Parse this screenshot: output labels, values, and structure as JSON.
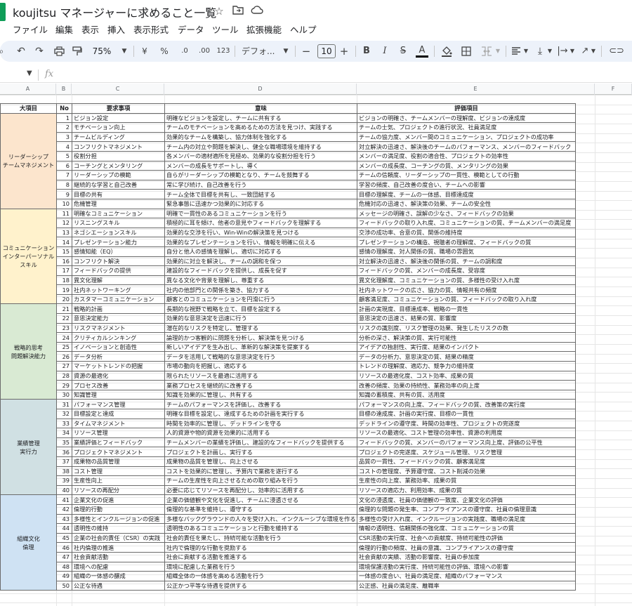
{
  "app": {
    "title": "koujitsu マネージャーに求めること一覧",
    "icons": [
      "star-icon",
      "move-to-folder-icon",
      "cloud-status-icon"
    ]
  },
  "menu": [
    "ファイル",
    "編集",
    "表示",
    "挿入",
    "表示形式",
    "データ",
    "ツール",
    "拡張機能",
    "ヘルプ"
  ],
  "toolbar": {
    "zoom": "75%",
    "currency": "¥",
    "percent": "%",
    "dec_decrease": ".0",
    "dec_increase": ".00",
    "number_format": "123",
    "font": "デフォ...",
    "font_size": "10",
    "minus": "−",
    "plus": "+",
    "bold": "B",
    "italic": "I",
    "strike": "S",
    "text_color": "A"
  },
  "formula_bar": {
    "fx": "fx"
  },
  "columns": [
    "A",
    "B",
    "C",
    "D",
    "E",
    "F"
  ],
  "table": {
    "headers": [
      "大項目",
      "No",
      "要求事項",
      "意味",
      "評価項目"
    ],
    "categories": [
      {
        "label": "リーダーシップ\nチームマネジメント",
        "rows": 10,
        "color": "#fce5cd",
        "cls": "c-leader"
      },
      {
        "label": "コミュニケーション\nインターパーソナルスキル",
        "rows": 10,
        "color": "#fff2cc",
        "cls": "c-comm"
      },
      {
        "label": "戦略的思考\n問題解決能力",
        "rows": 10,
        "color": "#d9ead3",
        "cls": "c-strat"
      },
      {
        "label": "業績管理\n実行力",
        "rows": 10,
        "color": "#d0e0e3",
        "cls": "c-perf"
      },
      {
        "label": "組織文化\n倫理",
        "rows": 10,
        "color": "#cfe2f3",
        "cls": "c-org"
      }
    ],
    "rows": [
      [
        "1",
        "ビジョン設定",
        "明確なビジョンを設定し、チームに共有する",
        "ビジョンの明確さ、チームメンバーの理解度、ビジョンの達成度"
      ],
      [
        "2",
        "モチベーション向上",
        "チームのモチベーションを高めるための方法を見つけ、実践する",
        "チームの士気、プロジェクトの進行状況、社員満足度"
      ],
      [
        "3",
        "チームビルディング",
        "効果的なチームを構築し、協力体制を強化する",
        "チームの協力度、メンバー間のコミュニケーション、プロジェクトの成功率"
      ],
      [
        "4",
        "コンフリクトマネジメント",
        "チーム内の対立や問題を解決し、健全な職場環境を維持する",
        "対立解決の迅速さ、解決後のチームのパフォーマンス、メンバーのフィードバック"
      ],
      [
        "5",
        "役割分担",
        "各メンバーの適材適所を見極め、効果的な役割分担を行う",
        "メンバーの満足度、役割の適合性、プロジェクトの効率性"
      ],
      [
        "6",
        "コーチングとメンタリング",
        "メンバーの成長をサポートし、導く",
        "メンバーの成長度、コーチングの質、メンタリングの効果"
      ],
      [
        "7",
        "リーダーシップの模範",
        "自らがリーダーシップの模範となり、チームを鼓舞する",
        "チームの信頼度、リーダーシップの一貫性、模範としての行動"
      ],
      [
        "8",
        "継続的な学習と自己改善",
        "常に学び続け、自己改善を行う",
        "学習の頻度、自己改善の度合い、チームへの影響"
      ],
      [
        "9",
        "目標の共有",
        "チーム全体で目標を共有し、一致団結する",
        "目標の理解度、チームの一体感、目標達成度"
      ],
      [
        "10",
        "危機管理",
        "緊急事態に迅速かつ効果的に対応する",
        "危機対応の迅速さ、解決策の効果、チームの安全性"
      ],
      [
        "11",
        "明確なコミュニケーション",
        "明確で一貫性のあるコミュニケーションを行う",
        "メッセージの明確さ、誤解の少なさ、フィードバックの効果"
      ],
      [
        "12",
        "リスニングスキル",
        "積極的に耳を傾け、他者の意見やフィードバックを理解する",
        "フィードバックの取り入れ度、コミュニケーションの質、チームメンバーの満足度"
      ],
      [
        "13",
        "ネゴシエーションスキル",
        "効果的な交渉を行い、Win-Winの解決策を見つける",
        "交渉の成功率、合意の質、関係の維持度"
      ],
      [
        "14",
        "プレゼンテーション能力",
        "効果的なプレゼンテーションを行い、情報を明確に伝える",
        "プレゼンテーションの構造、視聴者の理解度、フィードバックの質"
      ],
      [
        "15",
        "感情知能（EQ）",
        "自分と他人の感情を理解し、適切に対応する",
        "感情の理解度、対人関係の質、職場の雰囲気"
      ],
      [
        "16",
        "コンフリクト解決",
        "効果的に対立を解決し、チームの調和を保つ",
        "対立解決の迅速さ、解決後の関係の質、チームの調和度"
      ],
      [
        "17",
        "フィードバックの提供",
        "建設的なフィードバックを提供し、成長を促す",
        "フィードバックの質、メンバーの成長度、受容度"
      ],
      [
        "18",
        "異文化理解",
        "異なる文化や背景を理解し、尊重する",
        "異文化理解度、コミュニケーションの質、多様性の受け入れ度"
      ],
      [
        "19",
        "社内ネットワーキング",
        "社内の他部門との関係を築き、協力する",
        "社内ネットワークの広さ、協力の質、情報共有の頻度"
      ],
      [
        "20",
        "カスタマーコミュニケーション",
        "顧客とのコミュニケーションを円滑に行う",
        "顧客満足度、コミュニケーションの質、フィードバックの取り入れ度"
      ],
      [
        "21",
        "戦略的計画",
        "長期的な視野で戦略を立て、目標を設定する",
        "計画の実現度、目標達成率、戦略の一貫性"
      ],
      [
        "22",
        "意思決定能力",
        "効果的な意思決定を迅速に行う",
        "意思決定の迅速さ、結果の質、影響度"
      ],
      [
        "23",
        "リスクマネジメント",
        "潜在的なリスクを特定し、管理する",
        "リスクの識別度、リスク管理の効果、発生したリスクの数"
      ],
      [
        "24",
        "クリティカルシンキング",
        "論理的かつ客観的に問題を分析し、解決策を見つける",
        "分析の深さ、解決策の質、実行可能性"
      ],
      [
        "25",
        "イノベーションと創造性",
        "新しいアイデアを生み出し、革新的な解決策を提案する",
        "アイデアの独創性、実行度、結果のインパクト"
      ],
      [
        "26",
        "データ分析",
        "データを活用して戦略的な意思決定を行う",
        "データの分析力、意思決定の質、結果の精度"
      ],
      [
        "27",
        "マーケットトレンドの把握",
        "市場の動向を把握し、適応する",
        "トレンドの理解度、適応力、競争力の維持度"
      ],
      [
        "28",
        "資源の最適化",
        "限られたリソースを最適に活用する",
        "リソースの最適化度、コスト効率、成果の質"
      ],
      [
        "29",
        "プロセス改善",
        "業務プロセスを継続的に改善する",
        "改善の頻度、効果の持続性、業務効率の向上度"
      ],
      [
        "30",
        "知識管理",
        "知識を効果的に管理し、共有する",
        "知識の蓄積度、共有の質、活用度"
      ],
      [
        "31",
        "パフォーマンス管理",
        "チームのパフォーマンスを評価し、改善する",
        "パフォーマンスの向上度、フィードバックの質、改善策の実行度"
      ],
      [
        "32",
        "目標設定と達成",
        "明確な目標を設定し、達成するための計画を実行する",
        "目標の達成度、計画の実行度、目標の一貫性"
      ],
      [
        "33",
        "タイムマネジメント",
        "時間を効率的に管理し、デッドラインを守る",
        "デッドラインの遵守度、時間の効率性、プロジェクトの完遂度"
      ],
      [
        "34",
        "リソース管理",
        "人的資源や物的資源を効果的に活用する",
        "リソースの最適化、コスト管理の効率性、資源の利用度"
      ],
      [
        "35",
        "業績評価とフィードバック",
        "チームメンバーの業績を評価し、建設的なフィードバックを提供する",
        "フィードバックの質、メンバーのパフォーマンス向上度、評価の公平性"
      ],
      [
        "36",
        "プロジェクトマネジメント",
        "プロジェクトを計画し、実行する",
        "プロジェクトの完遂度、スケジュール管理、リスク管理"
      ],
      [
        "37",
        "成果物の品質管理",
        "成果物の品質を管理し、向上させる",
        "品質の一貫性、フィードバックの質、顧客満足度"
      ],
      [
        "38",
        "コスト管理",
        "コストを効果的に管理し、予算内で業務を遂行する",
        "コストの管理度、予算遵守度、コスト削減の効果"
      ],
      [
        "39",
        "生産性向上",
        "チームの生産性を向上させるための取り組みを行う",
        "生産性の向上度、業務効率、成果の質"
      ],
      [
        "40",
        "リソースの再配分",
        "必要に応じてリソースを再配分し、効率的に活用する",
        "リソースの適応力、利用効率、成果の質"
      ],
      [
        "41",
        "企業文化の促進",
        "企業の価値観や文化を促進し、チームに浸透させる",
        "文化の浸透度、社員の価値観の一致度、企業文化の評価"
      ],
      [
        "42",
        "倫理的行動",
        "倫理的な基準を維持し、遵守する",
        "倫理的な問題の発生率、コンプライアンスの遵守度、社員の倫理意識"
      ],
      [
        "43",
        "多様性とインクルージョンの促進",
        "多様なバックグラウンドの人々を受け入れ、インクルーシブな環境を作る",
        "多様性の受け入れ度、インクルージョンの実践度、職場の満足度"
      ],
      [
        "44",
        "透明性の維持",
        "透明性のあるコミュニケーションと行動を維持する",
        "情報の透明性、信頼関係の強化度、コミュニケーションの質"
      ],
      [
        "45",
        "企業の社会的責任（CSR）の実践",
        "社会的責任を果たし、持続可能な活動を行う",
        "CSR活動の実行度、社会への貢献度、持続可能性の評価"
      ],
      [
        "46",
        "社内倫理の推進",
        "社内で倫理的な行動を奨励する",
        "倫理的行動の頻度、社員の意識、コンプライアンスの遵守度"
      ],
      [
        "47",
        "社会貢献活動",
        "社会に貢献する活動を推進する",
        "社会貢献の実績、活動の影響度、社員の参加度"
      ],
      [
        "48",
        "環境への配慮",
        "環境に配慮した業務を行う",
        "環境保護活動の実行度、持続可能性の評価、環境への影響"
      ],
      [
        "49",
        "組織の一体感の醸成",
        "組織全体の一体感を高める活動を行う",
        "一体感の度合い、社員の満足度、組織のパフォーマンス"
      ],
      [
        "50",
        "公正な待遇",
        "公正かつ平等な待遇を提供する",
        "公正感、社員の満足度、離職率"
      ]
    ]
  }
}
